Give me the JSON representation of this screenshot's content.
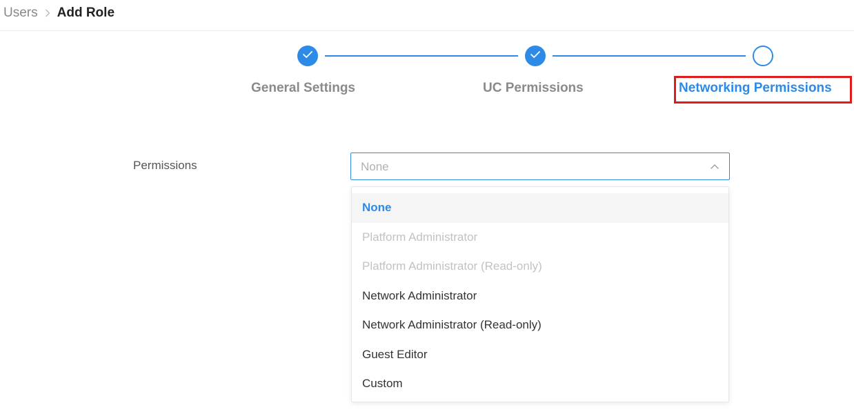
{
  "breadcrumb": {
    "parent": "Users",
    "current": "Add Role"
  },
  "stepper": {
    "steps": [
      {
        "label": "General Settings",
        "state": "done"
      },
      {
        "label": "UC Permissions",
        "state": "done"
      },
      {
        "label": "Networking Permissions",
        "state": "active"
      }
    ]
  },
  "form": {
    "permissions_label": "Permissions",
    "permissions_select": {
      "value": "None",
      "expanded": true,
      "options": [
        {
          "label": "None",
          "selected": true,
          "disabled": false
        },
        {
          "label": "Platform Administrator",
          "selected": false,
          "disabled": true
        },
        {
          "label": "Platform Administrator (Read-only)",
          "selected": false,
          "disabled": true
        },
        {
          "label": "Network Administrator",
          "selected": false,
          "disabled": false
        },
        {
          "label": "Network Administrator (Read-only)",
          "selected": false,
          "disabled": false
        },
        {
          "label": "Guest Editor",
          "selected": false,
          "disabled": false
        },
        {
          "label": "Custom",
          "selected": false,
          "disabled": false
        }
      ]
    }
  },
  "colors": {
    "accent": "#2d8ae6",
    "highlight": "#e01b1b",
    "disabled_text": "#c2c2c2"
  },
  "icons": {
    "breadcrumb_separator": "chevron-right-icon",
    "step_done": "check-icon",
    "select_arrow": "chevron-up-icon"
  }
}
